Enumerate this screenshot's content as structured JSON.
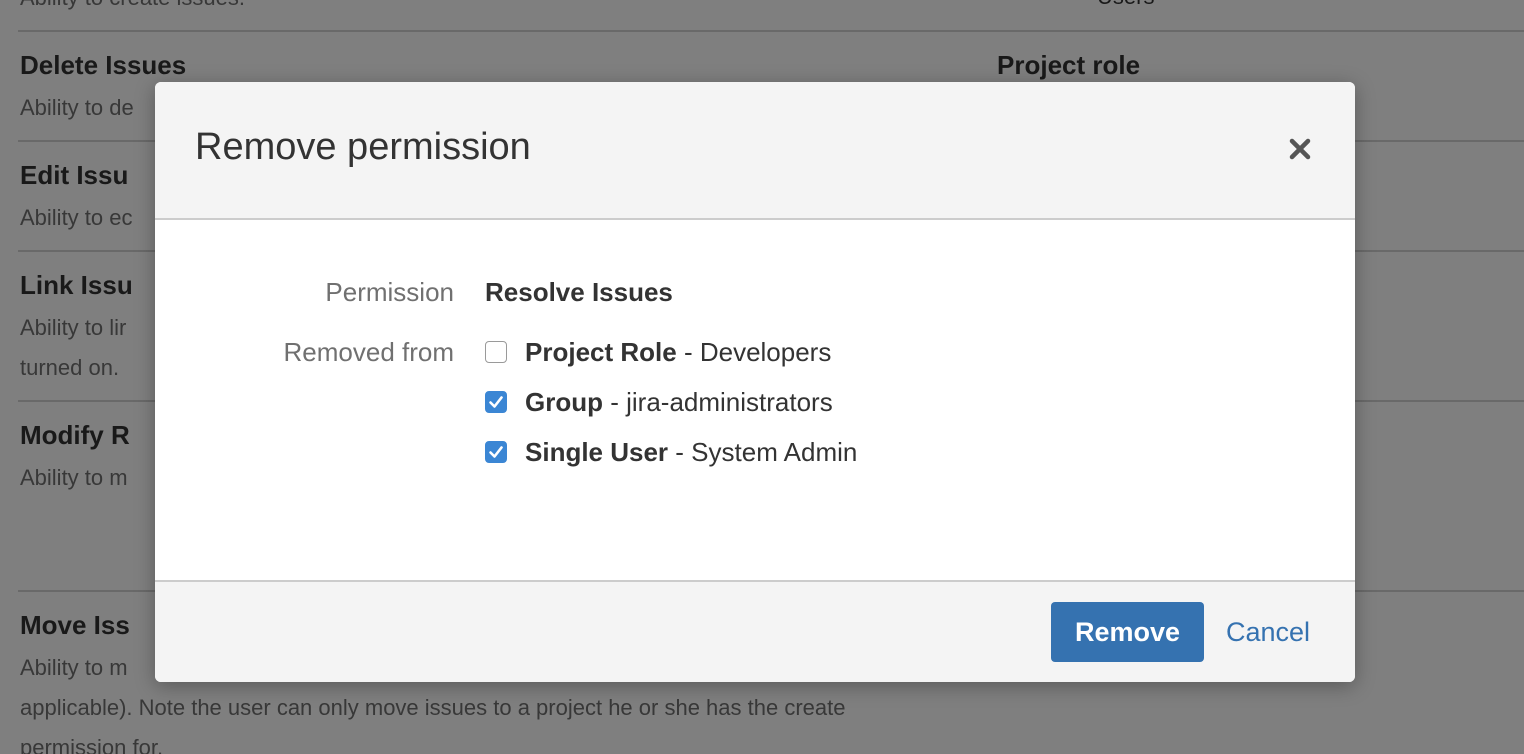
{
  "background": {
    "partial_top_desc": "Ability to create issues.",
    "partial_top_grant": "Users",
    "rows": [
      {
        "title": "Delete Issues",
        "desc": "Ability to de",
        "grant": "Project role"
      },
      {
        "title": "Edit Issu",
        "desc": "Ability to ec"
      },
      {
        "title": "Link Issu",
        "desc": "Ability to lir",
        "desc2": "turned on."
      },
      {
        "title": "Modify R",
        "desc": "Ability to m"
      },
      {
        "title": "Move Iss",
        "desc": "Ability to m",
        "desc2": "applicable). Note the user can only move issues to a project he or she has the create",
        "desc3": "permission for."
      }
    ]
  },
  "dialog": {
    "title": "Remove permission",
    "close_icon": "close-icon",
    "permission_label": "Permission",
    "permission_value": "Resolve Issues",
    "removed_from_label": "Removed from",
    "options": [
      {
        "type": "Project Role",
        "separator": " - ",
        "name": "Developers",
        "checked": false
      },
      {
        "type": "Group",
        "separator": " - ",
        "name": "jira-administrators",
        "checked": true
      },
      {
        "type": "Single User",
        "separator": " - ",
        "name": "System Admin",
        "checked": true
      }
    ],
    "remove_label": "Remove",
    "cancel_label": "Cancel"
  },
  "colors": {
    "primary": "#3572b0",
    "checkbox_checked": "#3b86d4",
    "overlay": "rgba(0,0,0,0.5)"
  }
}
